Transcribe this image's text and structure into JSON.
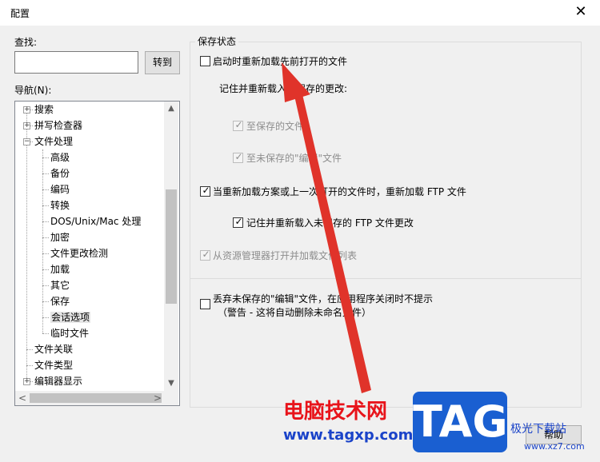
{
  "window": {
    "title": "配置",
    "close": "✕"
  },
  "left": {
    "search_label": "查找:",
    "search_value": "",
    "goto_label": "转到",
    "nav_label": "导航(N):",
    "tree": [
      {
        "label": "搜索",
        "expander": "+",
        "level": 0
      },
      {
        "label": "拼写检查器",
        "expander": "+",
        "level": 0
      },
      {
        "label": "文件处理",
        "expander": "−",
        "level": 0
      },
      {
        "label": "高级",
        "level": 1
      },
      {
        "label": "备份",
        "level": 1
      },
      {
        "label": "编码",
        "level": 1
      },
      {
        "label": "转换",
        "level": 1
      },
      {
        "label": "DOS/Unix/Mac 处理",
        "level": 1
      },
      {
        "label": "加密",
        "level": 1
      },
      {
        "label": "文件更改检测",
        "level": 1
      },
      {
        "label": "加载",
        "level": 1
      },
      {
        "label": "其它",
        "level": 1
      },
      {
        "label": "保存",
        "level": 1
      },
      {
        "label": "会话选项",
        "level": 1,
        "selected": true
      },
      {
        "label": "临时文件",
        "level": 1
      },
      {
        "label": "文件关联",
        "level": 0
      },
      {
        "label": "文件类型",
        "level": 0
      },
      {
        "label": "编辑器显示",
        "expander": "+",
        "level": 0
      }
    ],
    "scroll_up": "▲",
    "scroll_down": "▼",
    "scroll_left": "<",
    "scroll_right": ">"
  },
  "right": {
    "group_title": "保存状态",
    "opt_reload": {
      "label": "启动时重新加载先前打开的文件",
      "checked": false
    },
    "remember_label": "记住并重新载入未保存的更改:",
    "opt_to_saved": {
      "label": "至保存的文件",
      "checked": true,
      "disabled": true
    },
    "opt_to_unsaved": {
      "label": "至未保存的\"编辑\"文件",
      "checked": true,
      "disabled": true
    },
    "opt_ftp_reload": {
      "label": "当重新加载方案或上一次打开的文件时，重新加载 FTP 文件",
      "checked": true
    },
    "opt_ftp_remember": {
      "label": "记住并重新载入未保存的 FTP 文件更改",
      "checked": true
    },
    "opt_explorer": {
      "label": "从资源管理器打开并加载文件列表",
      "checked": true,
      "disabled": true
    },
    "opt_discard": {
      "label": "丢弃未保存的\"编辑\"文件，在应用程序关闭时不提示",
      "checked": false
    },
    "discard_note": "（警告 - 这将自动删除未命名文件）"
  },
  "footer": {
    "help_label": "帮助"
  },
  "watermark": {
    "text": "电脑技术网",
    "url": "www.tagxp.com",
    "logo": "TAG",
    "site": "极光下载站",
    "site_url": "www.xz7.com"
  },
  "colors": {
    "arrow": "#e0332a",
    "dialog_bg": "#f0f0f0"
  }
}
